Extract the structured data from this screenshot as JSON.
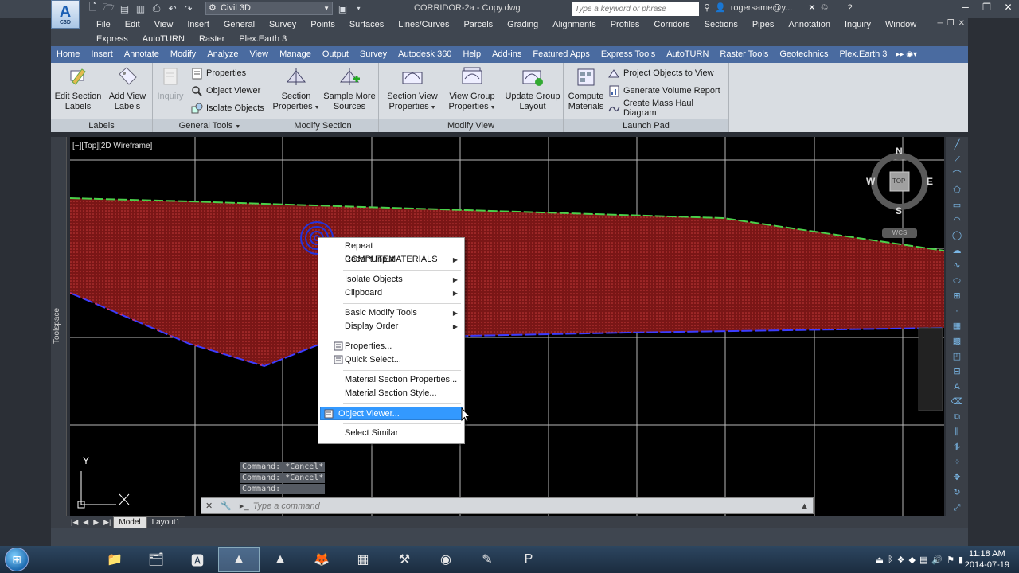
{
  "title_bar": {
    "workspace": "Civil 3D",
    "document_title": "CORRIDOR-2a - Copy.dwg",
    "search_placeholder": "Type a keyword or phrase",
    "user": "rogersame@y...",
    "app_logo_text": "A",
    "app_logo_sub": "C3D"
  },
  "menu_bar": {
    "row1": [
      "File",
      "Edit",
      "View",
      "Insert",
      "General",
      "Survey",
      "Points",
      "Surfaces",
      "Lines/Curves",
      "Parcels",
      "Grading",
      "Alignments",
      "Profiles",
      "Corridors",
      "Sections",
      "Pipes",
      "Annotation",
      "Inquiry",
      "Window"
    ],
    "row2": [
      "Express",
      "AutoTURN",
      "Raster",
      "Plex.Earth 3"
    ]
  },
  "ribbon_tabs": [
    "Home",
    "Insert",
    "Annotate",
    "Modify",
    "Analyze",
    "View",
    "Manage",
    "Output",
    "Survey",
    "Autodesk 360",
    "Help",
    "Add-ins",
    "Featured Apps",
    "Express Tools",
    "AutoTURN",
    "Raster Tools",
    "Geotechnics",
    "Plex.Earth 3"
  ],
  "ribbon": {
    "labels_panel": {
      "label": "Labels",
      "edit_section_labels": [
        "Edit Section",
        "Labels"
      ],
      "add_view_labels": [
        "Add View",
        "Labels"
      ]
    },
    "general_tools_panel": {
      "label": "General Tools",
      "inquiry": "Inquiry",
      "properties": "Properties",
      "object_viewer": "Object Viewer",
      "isolate_objects": "Isolate Objects"
    },
    "modify_section_panel": {
      "label": "Modify Section",
      "section_properties": [
        "Section",
        "Properties"
      ],
      "sample_more_sources": [
        "Sample More",
        "Sources"
      ]
    },
    "modify_view_panel": {
      "label": "Modify View",
      "section_view_properties": [
        "Section View",
        "Properties"
      ],
      "view_group_properties": [
        "View Group",
        "Properties"
      ],
      "update_group_layout": [
        "Update Group",
        "Layout"
      ]
    },
    "launch_pad_panel": {
      "label": "Launch Pad",
      "compute_materials": [
        "Compute",
        "Materials"
      ],
      "project_objects_to_view": "Project Objects to View",
      "generate_volume_report": "Generate Volume Report",
      "create_mass_haul_diagram": "Create Mass Haul Diagram"
    }
  },
  "toolspace_label": "Toolspace",
  "viewport": {
    "label": "[−][Top][2D Wireframe]",
    "viewcube": {
      "north": "N",
      "south": "S",
      "east": "E",
      "west": "W",
      "face": "TOP",
      "wcs": "WCS"
    },
    "ucs_y": "Y"
  },
  "context_menu": {
    "items": [
      {
        "label": "Repeat COMPUTEMATERIALS",
        "submenu": false
      },
      {
        "label": "Recent Input",
        "submenu": true
      },
      {
        "label": "Isolate Objects",
        "submenu": true
      },
      {
        "label": "Clipboard",
        "submenu": true
      },
      {
        "label": "Basic Modify Tools",
        "submenu": true
      },
      {
        "label": "Display Order",
        "submenu": true
      },
      {
        "label": "Properties...",
        "submenu": false
      },
      {
        "label": "Quick Select...",
        "submenu": false
      },
      {
        "label": "Material Section Properties...",
        "submenu": false
      },
      {
        "label": "Material Section Style...",
        "submenu": false
      },
      {
        "label": "Object Viewer...",
        "submenu": false
      },
      {
        "label": "Select Similar",
        "submenu": false
      }
    ]
  },
  "command_line": {
    "history": [
      "Command: *Cancel*",
      "Command: *Cancel*",
      "Command:"
    ],
    "placeholder": "Type a command"
  },
  "layout_tabs": [
    "Model",
    "Layout1"
  ],
  "taskbar": {
    "time": "11:18 AM",
    "date": "2014-07-19"
  },
  "colors": {
    "section_fill": "#8b1a1a",
    "top_line": "#4ad04a",
    "bottom_line": "#3c3cff",
    "highlight": "#3399ff"
  }
}
